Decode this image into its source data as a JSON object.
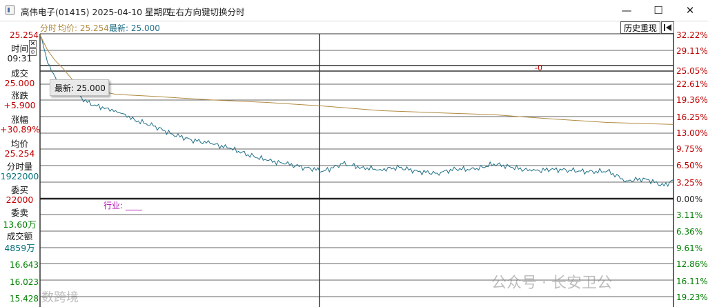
{
  "window": {
    "title": "高伟电子(01415) 2025-04-10 星期四",
    "hint": "左右方向键切换分时",
    "minimize": "—",
    "maximize": "☐",
    "close": "✕"
  },
  "header": {
    "label": "分时",
    "avg_label": "均价: 25.254",
    "last_label": "最新: 25.000",
    "history_button": "历史重现"
  },
  "info_panel": [
    {
      "label": "时间",
      "value": "09:31",
      "color": "#222222"
    },
    {
      "label": "成交",
      "value": "25.000",
      "color": "#c00000"
    },
    {
      "label": "涨跌",
      "value": "+5.900",
      "color": "#c00000"
    },
    {
      "label": "涨幅",
      "value": "+30.89%",
      "color": "#c00000"
    },
    {
      "label": "均价",
      "value": "25.254",
      "color": "#c00000"
    },
    {
      "label": "分时量",
      "value": "1922000",
      "color": "#00707a"
    },
    {
      "label": "委买",
      "value": "22000",
      "color": "#c00000"
    },
    {
      "label": "委卖",
      "value": "13.60万",
      "color": "#008000"
    },
    {
      "label": "成交额",
      "value": "4859万",
      "color": "#00707a"
    }
  ],
  "tooltip": "最新: 25.000",
  "industry_label": "行业: ____",
  "zero_marker": "-0",
  "colors": {
    "price_line": "#1f6f86",
    "avg_line": "#b08a40",
    "up": "#c00000",
    "down": "#008000",
    "grid": "#333333"
  },
  "chart_data": {
    "type": "line",
    "left_axis_labels": [
      "25.254",
      "16.643",
      "16.023",
      "15.428"
    ],
    "right_axis_labels": [
      "32.22%",
      "29.11%",
      "25.05%",
      "22.61%",
      "19.36%",
      "16.25%",
      "13.00%",
      "9.75%",
      "6.50%",
      "3.25%",
      "0.00%",
      "3.11%",
      "6.36%",
      "9.61%",
      "12.86%",
      "16.11%",
      "19.23%"
    ],
    "series": [
      {
        "name": "最新",
        "x": [
          0,
          2,
          4,
          6,
          8,
          10,
          12,
          14,
          16,
          18,
          20,
          25,
          30,
          35,
          40,
          45,
          50,
          60,
          70,
          80,
          90,
          100,
          110,
          120,
          130,
          140,
          150,
          160,
          170,
          180,
          190,
          200,
          210,
          220,
          230,
          240,
          250,
          260,
          270,
          280,
          290,
          300,
          310,
          320,
          330,
          335
        ],
        "y": [
          32.0,
          29.5,
          26.5,
          25.0,
          23.8,
          23.0,
          22.6,
          22.2,
          21.6,
          21.2,
          20.3,
          18.8,
          18.1,
          17.7,
          17.2,
          16.5,
          15.4,
          14.2,
          12.6,
          11.5,
          10.8,
          9.9,
          8.6,
          7.5,
          6.8,
          6.1,
          5.4,
          6.8,
          6.1,
          5.7,
          6.1,
          5.3,
          5.0,
          5.8,
          5.7,
          6.8,
          6.1,
          5.4,
          5.7,
          5.6,
          5.2,
          5.4,
          3.5,
          3.9,
          2.5,
          3.7
        ]
      },
      {
        "name": "均价",
        "x": [
          0,
          4,
          8,
          12,
          20,
          40,
          60,
          90,
          120,
          150,
          180,
          210,
          240,
          270,
          300,
          335
        ],
        "y": [
          32.0,
          29.0,
          27.0,
          25.5,
          22.0,
          20.4,
          20.0,
          19.3,
          18.8,
          18.1,
          17.2,
          16.8,
          16.4,
          15.6,
          14.9,
          14.5
        ]
      }
    ],
    "ylim_pct": [
      -19.23,
      32.22
    ],
    "grid": true
  },
  "watermarks": [
    "公众号 · 长安卫公",
    "数跨境"
  ]
}
